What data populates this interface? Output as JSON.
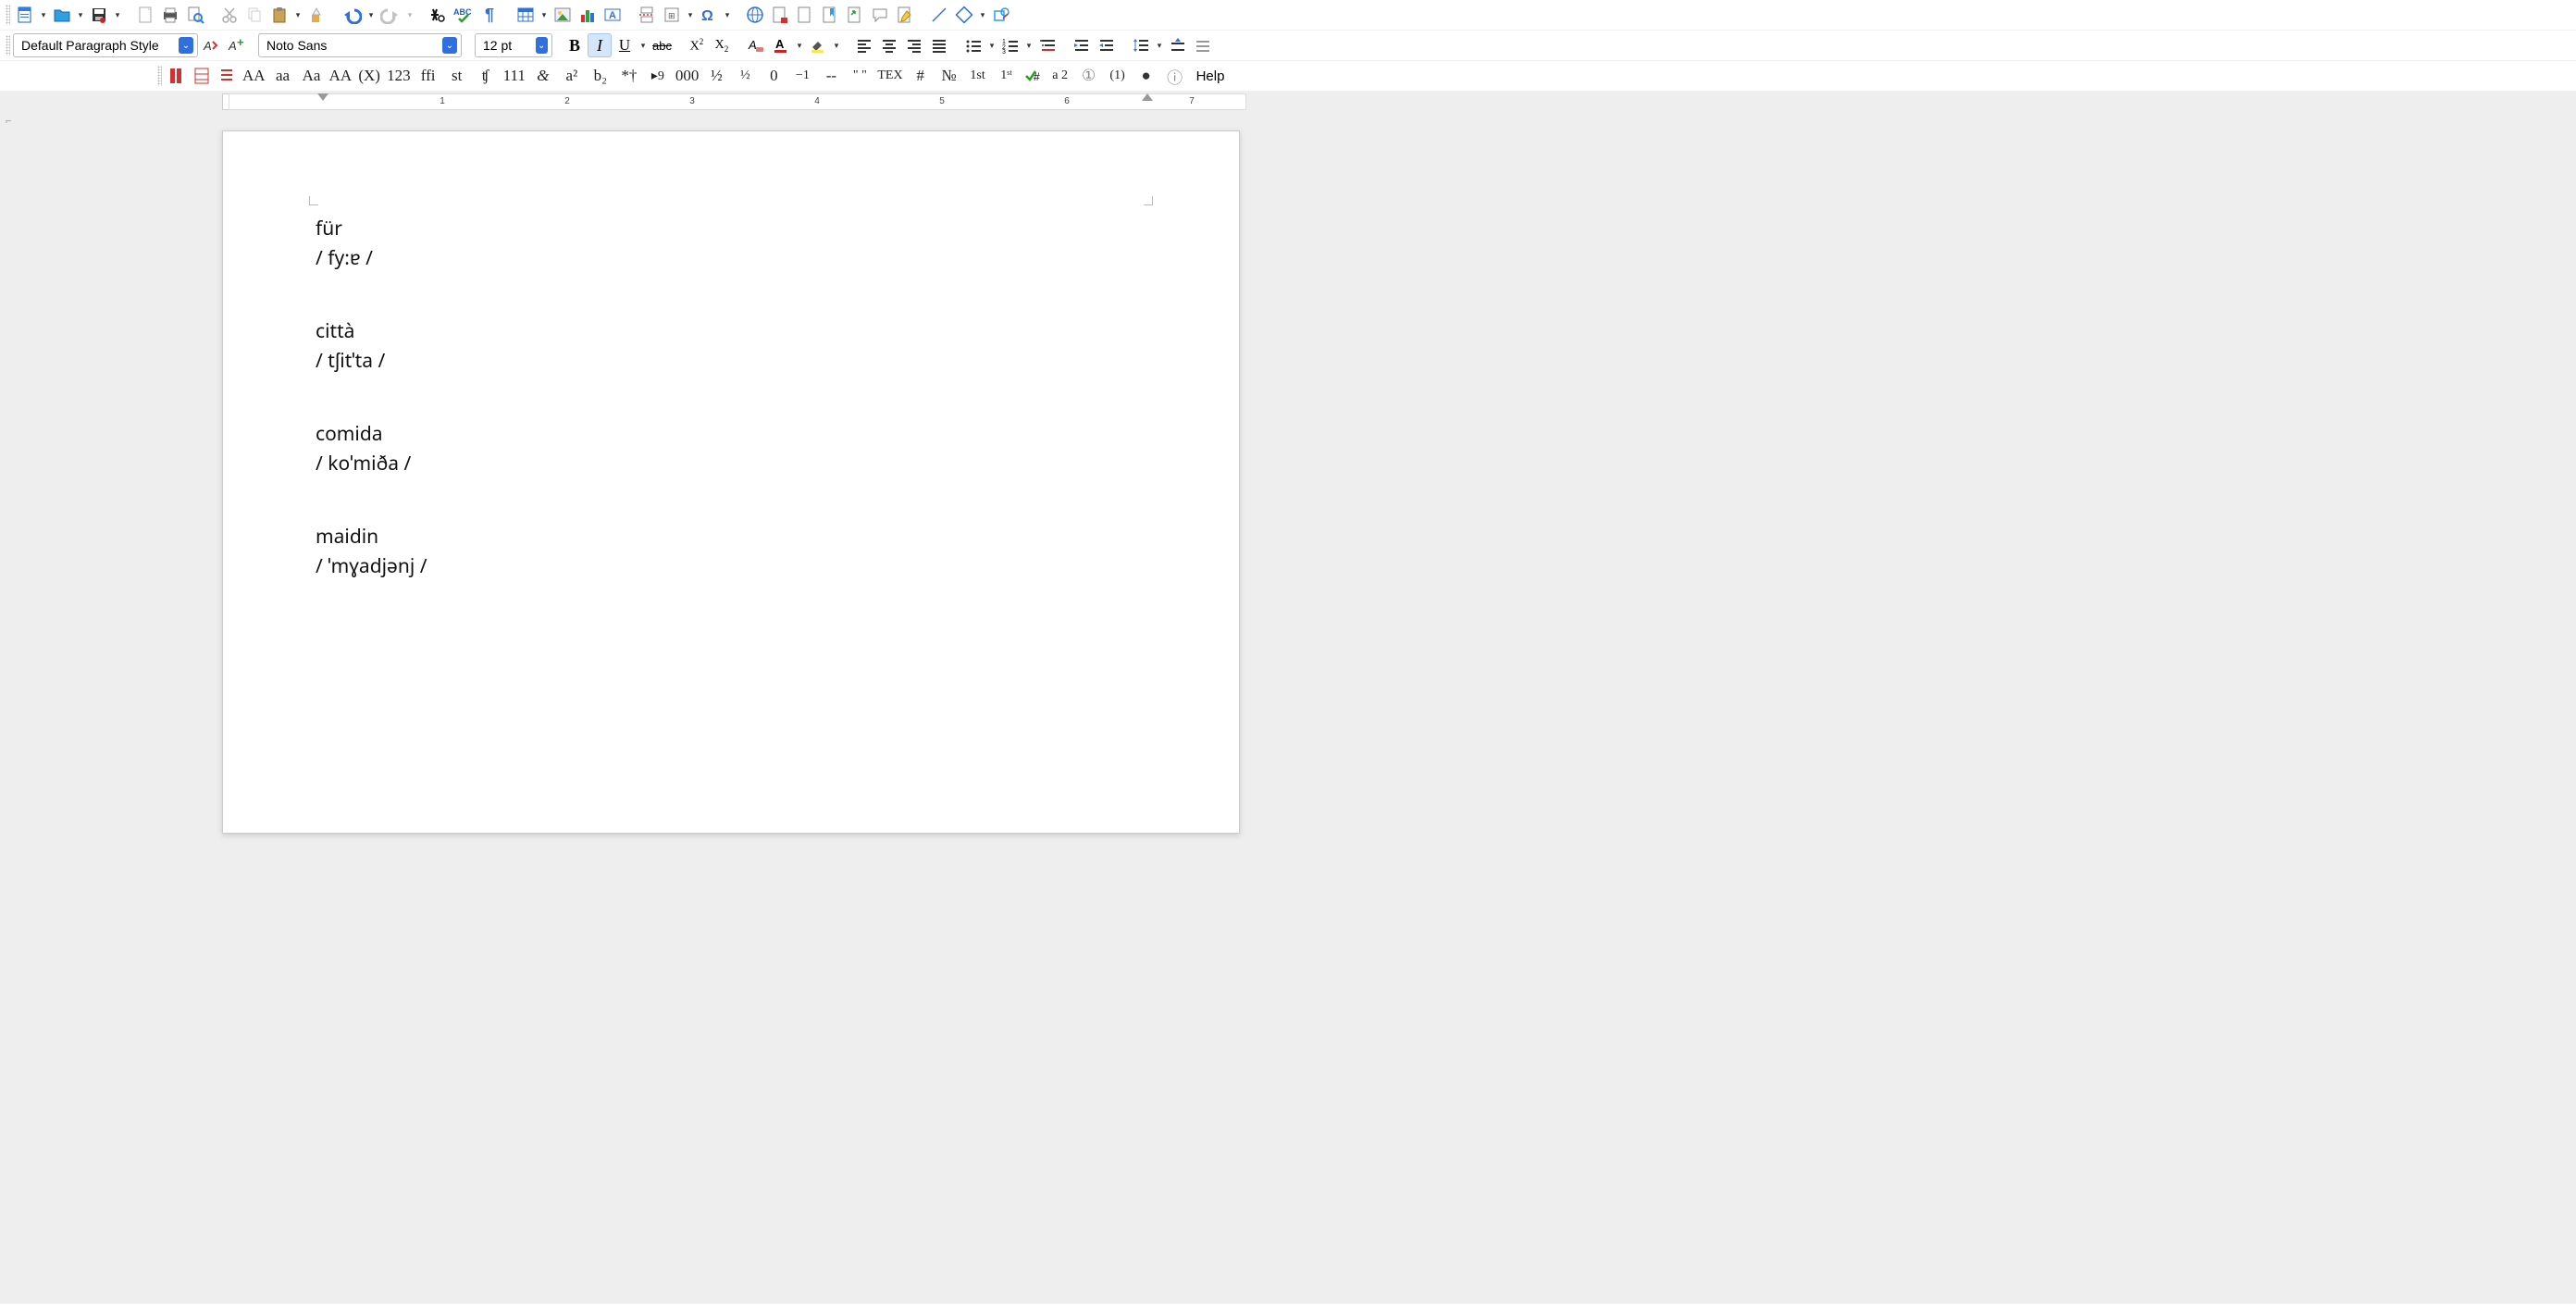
{
  "para_style": {
    "value": "Default Paragraph Style"
  },
  "font_name": {
    "value": "Noto Sans"
  },
  "font_size": {
    "value": "12 pt"
  },
  "ruler": {
    "nums": [
      "1",
      "2",
      "3",
      "4",
      "5",
      "6",
      "7"
    ]
  },
  "row3": {
    "uppercase": "AA",
    "lowercase": "aa",
    "title": "Aa",
    "upper2": "AA",
    "x": "(X)",
    "num": "123",
    "fi": "ffi",
    "st": "st",
    "tz": "ʧ",
    "n111": "111",
    "curly": "&",
    "asup": "a²",
    "bsub": "b₂",
    "star": "*†",
    "arrow9": "▸9",
    "zeros": "000",
    "half": "½",
    "frac": "½",
    "zero": "0",
    "minus1": "−1",
    "dash": "--",
    "dquote": "\" \"",
    "tex": "TEX",
    "hash": "#",
    "numero": "№",
    "first": "1st",
    "firstsup": "1ˢᵗ",
    "a2": "a 2",
    "circ1": "①",
    "paren1": "(1)",
    "bullet": "●",
    "circi": "ⓘ",
    "help": "Help"
  },
  "doc": {
    "blocks": [
      {
        "word": "für",
        "ipa": "/ fy:ɐ /"
      },
      {
        "word": "città",
        "ipa": "/ tʃitˈta /"
      },
      {
        "word": "comida",
        "ipa": "/ koˈmiða /"
      },
      {
        "word": "maidin",
        "ipa": "/ ˈmɣadjənj /"
      }
    ]
  }
}
